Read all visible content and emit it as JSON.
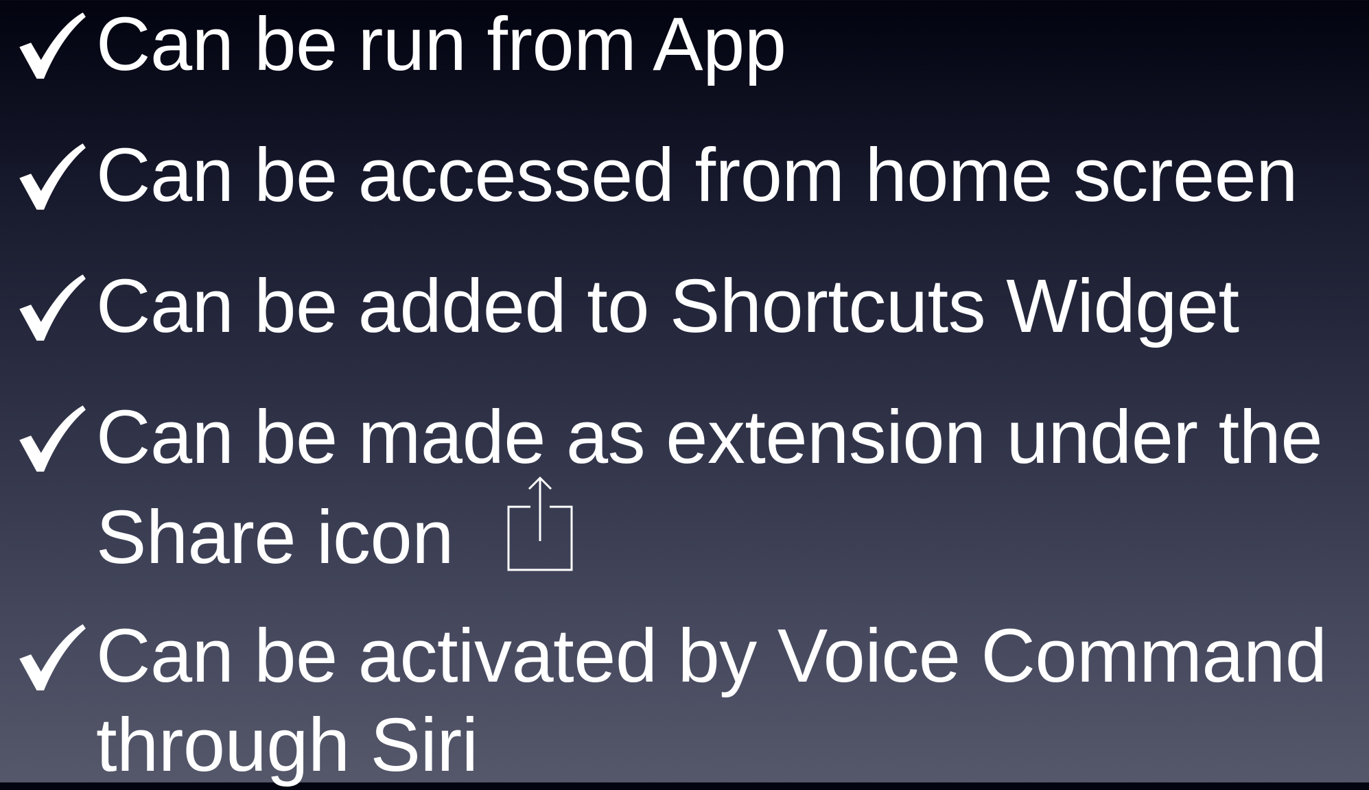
{
  "slide": {
    "items": [
      {
        "text_lines": [
          "Can be run from App"
        ]
      },
      {
        "text_lines": [
          "Can be accessed from home screen"
        ]
      },
      {
        "text_lines": [
          "Can be added to Shortcuts Widget"
        ]
      },
      {
        "text_lines": [
          "Can be made as extension under the",
          "Share icon"
        ],
        "trailing_icon": "share-icon"
      },
      {
        "text_lines": [
          "Can be activated by Voice Command",
          "through Siri"
        ]
      }
    ]
  },
  "colors": {
    "background_top": "#02030f",
    "background_bottom": "#55576a",
    "text": "#ffffff"
  },
  "icons": {
    "bullet": "checkmark-icon",
    "share": "share-icon"
  }
}
